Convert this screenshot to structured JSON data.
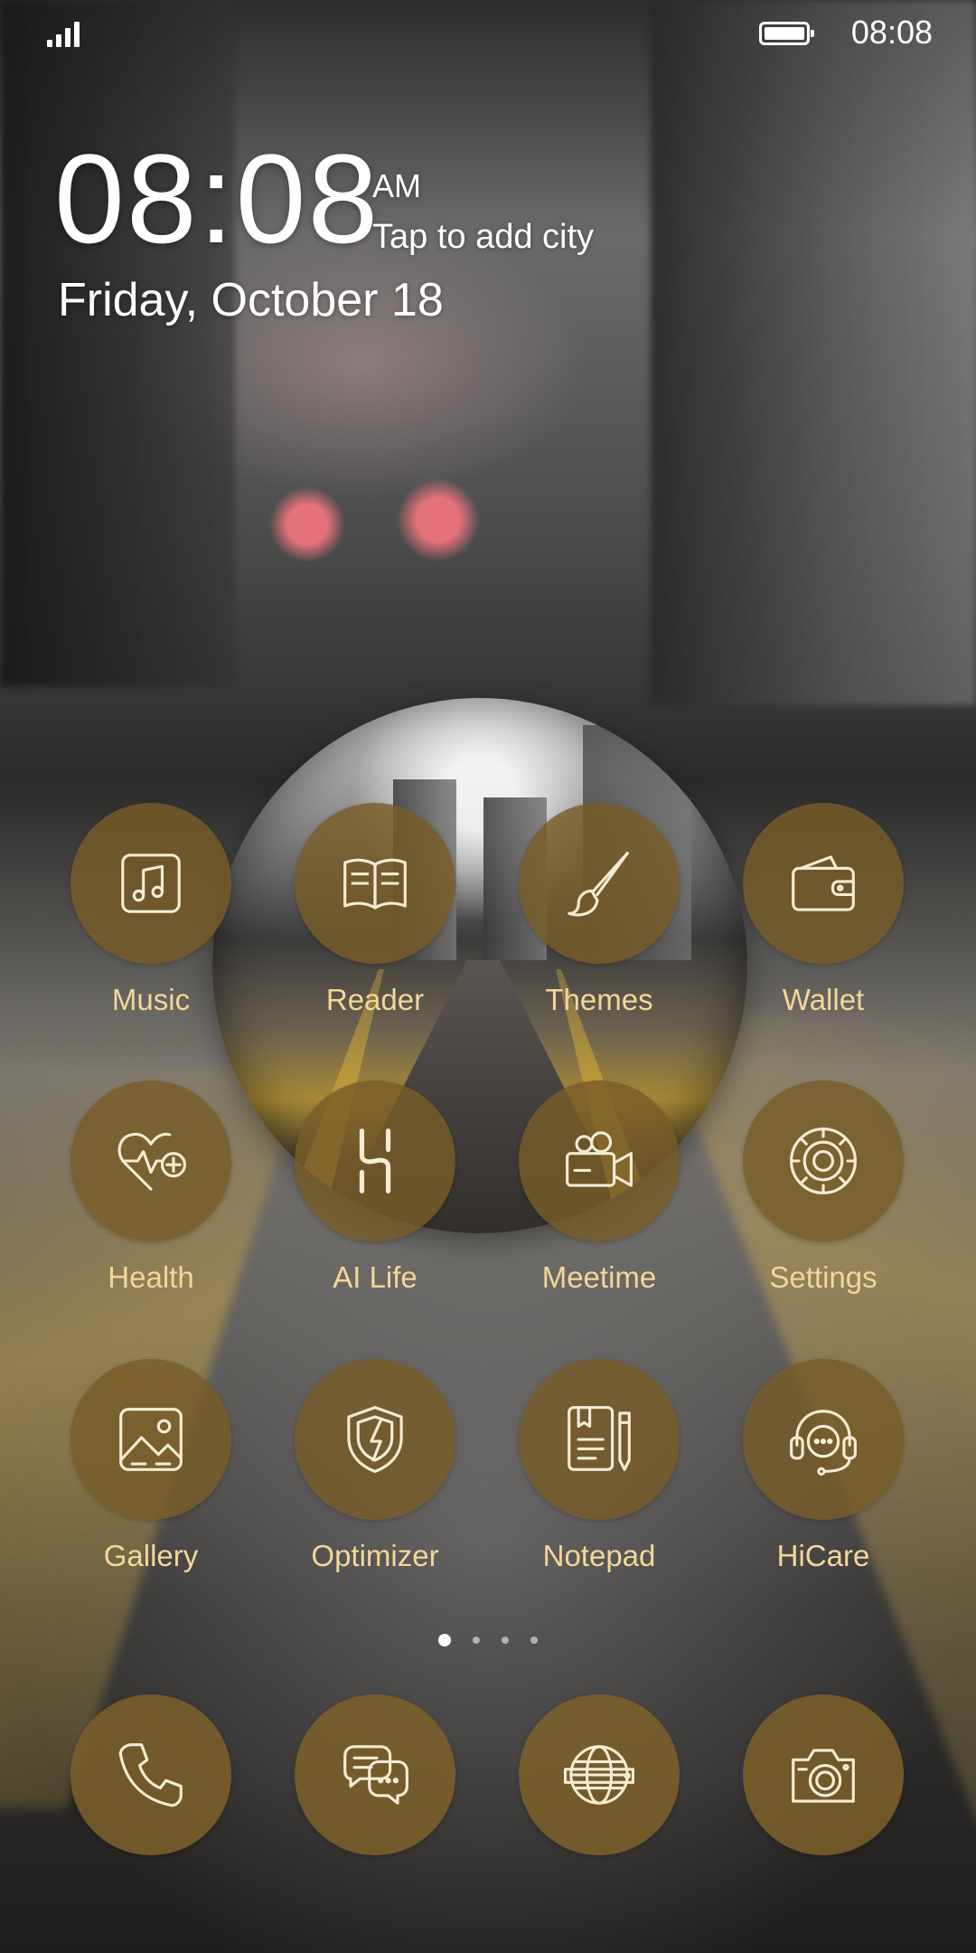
{
  "status_bar": {
    "time": "08:08",
    "signal_icon": "signal-icon",
    "battery_icon": "battery-icon",
    "battery_level": 1.0
  },
  "lock_widget": {
    "clock": "08:08",
    "ampm": "AM",
    "weather_prompt": "Tap to add city",
    "date": "Friday, October 18"
  },
  "home_apps": [
    {
      "label": "Music",
      "icon": "music-icon"
    },
    {
      "label": "Reader",
      "icon": "book-icon"
    },
    {
      "label": "Themes",
      "icon": "paintbrush-icon"
    },
    {
      "label": "Wallet",
      "icon": "wallet-icon"
    },
    {
      "label": "Health",
      "icon": "heart-pulse-icon"
    },
    {
      "label": "AI Life",
      "icon": "ai-life-icon"
    },
    {
      "label": "Meetime",
      "icon": "video-camera-icon"
    },
    {
      "label": "Settings",
      "icon": "gear-icon"
    },
    {
      "label": "Gallery",
      "icon": "image-icon"
    },
    {
      "label": "Optimizer",
      "icon": "shield-icon"
    },
    {
      "label": "Notepad",
      "icon": "notepad-icon"
    },
    {
      "label": "HiCare",
      "icon": "headset-icon"
    }
  ],
  "page_indicator": {
    "pages": 4,
    "current": 1
  },
  "dock_apps": [
    {
      "icon": "phone-icon"
    },
    {
      "icon": "messaging-icon"
    },
    {
      "icon": "browser-icon"
    },
    {
      "icon": "camera-icon"
    }
  ],
  "colors": {
    "icon_background": "#7a5c28",
    "icon_glyph": "#f6ecd4",
    "app_label": "#f3d79a"
  }
}
